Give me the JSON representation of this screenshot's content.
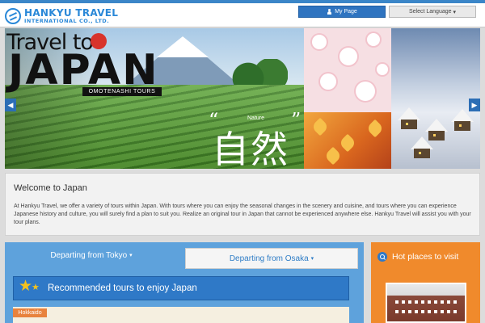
{
  "header": {
    "logo_name": "HANKYU TRAVEL",
    "logo_sub": "INTERNATIONAL CO., LTD.",
    "mypage_label": "My Page",
    "language_label": "Select Language",
    "language_caret": "▾"
  },
  "hero": {
    "travel_to": "Travel to",
    "japan": "JAPAN",
    "tagline": "OMOTENASHI TOURS",
    "quote_open": "“",
    "quote_close": "”",
    "nature_label": "Nature",
    "kanji": "自然",
    "arrow_left": "◀",
    "arrow_right": "▶"
  },
  "welcome": {
    "title": "Welcome to Japan",
    "text": "At Hankyu Travel, we offer a variety of tours within Japan. With tours where you can enjoy the seasonal changes in the scenery and cuisine, and tours where you can experience Japanese history and culture, you will surely find a plan to suit you. Realize an original tour in Japan that cannot be experienced anywhere else. Hankyu Travel will assist you with your tour plans."
  },
  "tabs": [
    {
      "label": "Departing from Tokyo",
      "caret": "▾",
      "active": true
    },
    {
      "label": "Departing from Osaka",
      "caret": "▾",
      "active": false
    }
  ],
  "recommended": {
    "title": "Recommended tours to enjoy Japan",
    "star": "★"
  },
  "region": {
    "badge": "Hokkaido"
  },
  "sidebar": {
    "hot_places": "Hot places to visit"
  },
  "icons": {
    "user": "user-icon",
    "search": "search-icon",
    "star": "star-icon"
  },
  "colors": {
    "brand_blue": "#2a88d8",
    "button_blue": "#2f74c0",
    "tab_blue": "#5ea2dc",
    "orange": "#f08a2c"
  }
}
